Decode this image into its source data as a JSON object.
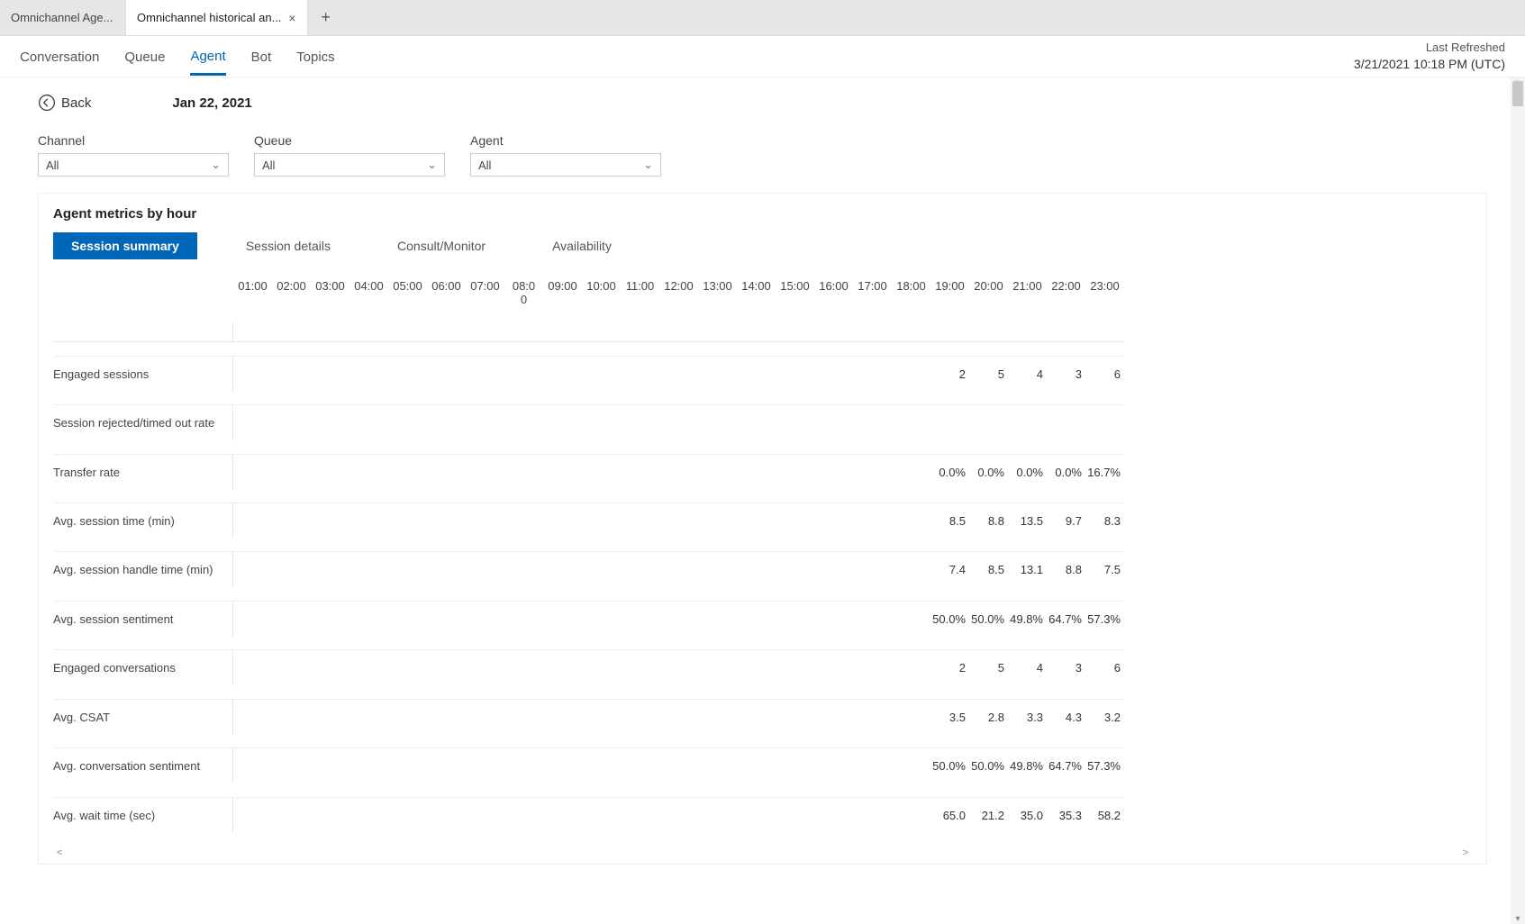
{
  "tabs": [
    {
      "label": "Omnichannel Age...",
      "active": false
    },
    {
      "label": "Omnichannel historical an...",
      "active": true
    },
    {
      "label": "+",
      "active": false,
      "new": true
    }
  ],
  "subnav": {
    "items": [
      "Conversation",
      "Queue",
      "Agent",
      "Bot",
      "Topics"
    ],
    "active_index": 2,
    "refresh_label": "Last Refreshed",
    "refresh_value": "3/21/2021 10:18 PM (UTC)"
  },
  "back": {
    "label": "Back"
  },
  "date": "Jan 22, 2021",
  "filters": [
    {
      "label": "Channel",
      "value": "All"
    },
    {
      "label": "Queue",
      "value": "All"
    },
    {
      "label": "Agent",
      "value": "All"
    }
  ],
  "card": {
    "title": "Agent metrics by hour",
    "tabs": [
      "Session summary",
      "Session details",
      "Consult/Monitor",
      "Availability"
    ],
    "active_tab_index": 0
  },
  "chart_data": {
    "type": "table",
    "columns": [
      "01:00",
      "02:00",
      "03:00",
      "04:00",
      "05:00",
      "06:00",
      "07:00",
      "08:00",
      "09:00",
      "10:00",
      "11:00",
      "12:00",
      "13:00",
      "14:00",
      "15:00",
      "16:00",
      "17:00",
      "18:00",
      "19:00",
      "20:00",
      "21:00",
      "22:00",
      "23:00"
    ],
    "column_sub": {
      "08:00": "0"
    },
    "rows": [
      {
        "label": "Engaged sessions",
        "values": [
          "",
          "",
          "",
          "",
          "",
          "",
          "",
          "",
          "",
          "",
          "",
          "",
          "",
          "",
          "",
          "",
          "",
          "",
          "2",
          "5",
          "4",
          "3",
          "6"
        ]
      },
      {
        "label": "Session rejected/timed out rate",
        "values": [
          "",
          "",
          "",
          "",
          "",
          "",
          "",
          "",
          "",
          "",
          "",
          "",
          "",
          "",
          "",
          "",
          "",
          "",
          "",
          "",
          "",
          "",
          ""
        ]
      },
      {
        "label": "Transfer rate",
        "values": [
          "",
          "",
          "",
          "",
          "",
          "",
          "",
          "",
          "",
          "",
          "",
          "",
          "",
          "",
          "",
          "",
          "",
          "",
          "0.0%",
          "0.0%",
          "0.0%",
          "0.0%",
          "16.7%"
        ]
      },
      {
        "label": "Avg. session time (min)",
        "values": [
          "",
          "",
          "",
          "",
          "",
          "",
          "",
          "",
          "",
          "",
          "",
          "",
          "",
          "",
          "",
          "",
          "",
          "",
          "8.5",
          "8.8",
          "13.5",
          "9.7",
          "8.3"
        ]
      },
      {
        "label": "Avg. session handle time (min)",
        "values": [
          "",
          "",
          "",
          "",
          "",
          "",
          "",
          "",
          "",
          "",
          "",
          "",
          "",
          "",
          "",
          "",
          "",
          "",
          "7.4",
          "8.5",
          "13.1",
          "8.8",
          "7.5"
        ]
      },
      {
        "label": "Avg. session sentiment",
        "values": [
          "",
          "",
          "",
          "",
          "",
          "",
          "",
          "",
          "",
          "",
          "",
          "",
          "",
          "",
          "",
          "",
          "",
          "",
          "50.0%",
          "50.0%",
          "49.8%",
          "64.7%",
          "57.3%"
        ]
      },
      {
        "label": "Engaged conversations",
        "values": [
          "",
          "",
          "",
          "",
          "",
          "",
          "",
          "",
          "",
          "",
          "",
          "",
          "",
          "",
          "",
          "",
          "",
          "",
          "2",
          "5",
          "4",
          "3",
          "6"
        ]
      },
      {
        "label": "Avg. CSAT",
        "values": [
          "",
          "",
          "",
          "",
          "",
          "",
          "",
          "",
          "",
          "",
          "",
          "",
          "",
          "",
          "",
          "",
          "",
          "",
          "3.5",
          "2.8",
          "3.3",
          "4.3",
          "3.2"
        ]
      },
      {
        "label": "Avg. conversation sentiment",
        "values": [
          "",
          "",
          "",
          "",
          "",
          "",
          "",
          "",
          "",
          "",
          "",
          "",
          "",
          "",
          "",
          "",
          "",
          "",
          "50.0%",
          "50.0%",
          "49.8%",
          "64.7%",
          "57.3%"
        ]
      },
      {
        "label": "Avg. wait time (sec)",
        "values": [
          "",
          "",
          "",
          "",
          "",
          "",
          "",
          "",
          "",
          "",
          "",
          "",
          "",
          "",
          "",
          "",
          "",
          "",
          "65.0",
          "21.2",
          "35.0",
          "35.3",
          "58.2"
        ]
      }
    ]
  }
}
